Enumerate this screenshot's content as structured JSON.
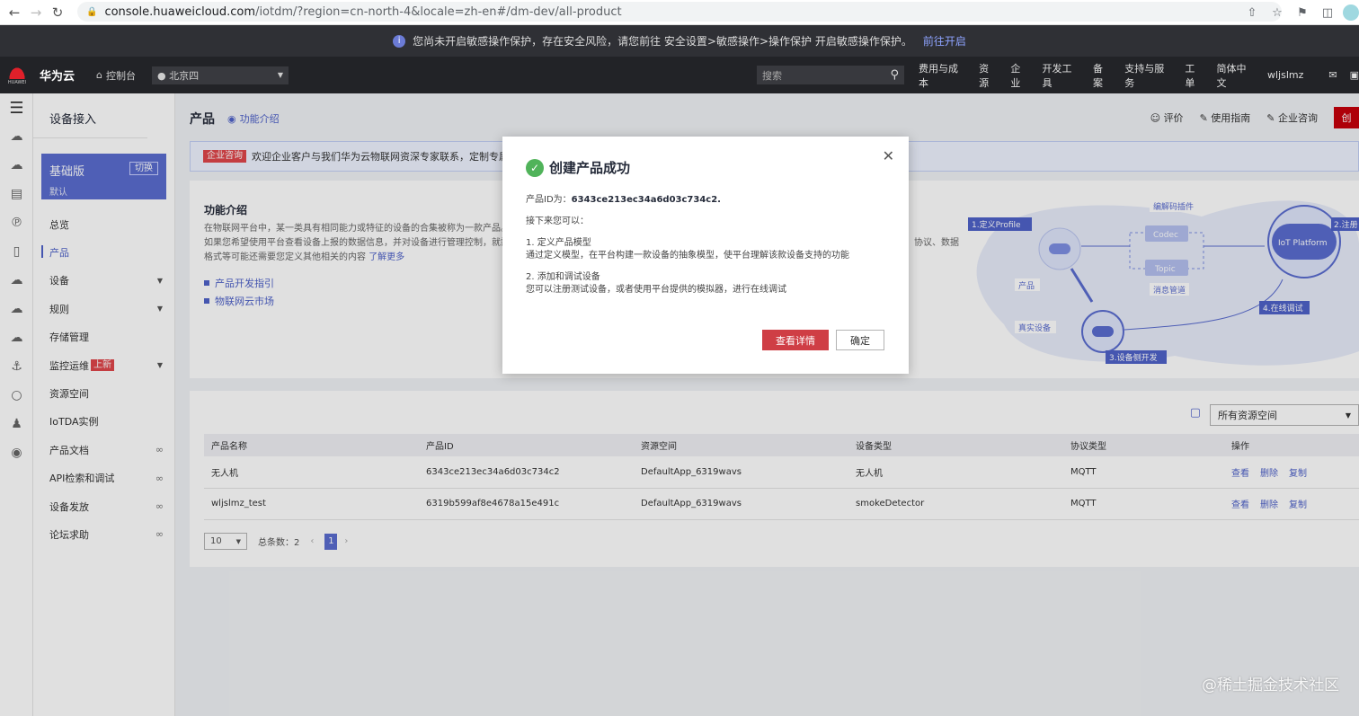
{
  "browser": {
    "url_host": "console.huaweicloud.com",
    "url_path": "/iotdm/?region=cn-north-4&locale=zh-en#/dm-dev/all-product"
  },
  "warning": {
    "text": "您尚未开启敏感操作保护，存在安全风险，请您前往 安全设置>敏感操作>操作保护 开启敏感操作保护。",
    "link": "前往开启"
  },
  "topnav": {
    "logo_text": "HUAWEI",
    "brand": "华为云",
    "console": "控制台",
    "region": "北京四",
    "search_placeholder": "搜索",
    "menu": [
      "费用与成本",
      "资源",
      "企业",
      "开发工具",
      "备案",
      "支持与服务",
      "工单",
      "简体中文",
      "wljslmz"
    ]
  },
  "sidebar": {
    "title": "设备接入",
    "edition": "基础版",
    "edition_sub": "默认",
    "switch": "切换",
    "items": [
      {
        "label": "总览"
      },
      {
        "label": "产品"
      },
      {
        "label": "设备"
      },
      {
        "label": "规则"
      },
      {
        "label": "存储管理"
      },
      {
        "label": "监控运维"
      },
      {
        "label": "资源空间"
      },
      {
        "label": "IoTDA实例"
      },
      {
        "label": "产品文档"
      },
      {
        "label": "API检索和调试"
      },
      {
        "label": "设备发放"
      },
      {
        "label": "论坛求助"
      }
    ],
    "new_badge": "上新"
  },
  "main": {
    "title": "产品",
    "func_intro": "功能介绍",
    "actions": [
      "评价",
      "使用指南",
      "企业咨询"
    ],
    "create": "创",
    "promo_tag": "企业咨询",
    "promo_text": "欢迎企业客户与我们华为云物联网资深专家联系，定制专属物联网",
    "intro": {
      "title": "功能介绍",
      "line1": "在物联网平台中，某一类具有相同能力或特征的设备的合集被称为一款产品。",
      "line2": "如果您希望使用平台查看设备上报的数据信息，并对设备进行管理控制，就需",
      "line2_tail": "协议、数据",
      "line3": "格式等可能还需要您定义其他相关的内容",
      "more": "了解更多",
      "links": [
        "产品开发指引",
        "物联网云市场"
      ]
    },
    "flow": {
      "step1": "1.定义Profile",
      "step2": "2.注册",
      "step3": "3.设备侧开发",
      "step4": "4.在线调试",
      "codec_plugin": "编解码插件",
      "codec": "Codec",
      "topic": "Topic",
      "msg_pipe": "消息管道",
      "product": "产品",
      "real_device": "真实设备",
      "iot_platform": "IoT Platform"
    }
  },
  "table": {
    "space_select": "所有资源空间",
    "headers": [
      "产品名称",
      "产品ID",
      "资源空间",
      "设备类型",
      "协议类型",
      "操作"
    ],
    "rows": [
      {
        "name": "无人机",
        "id": "6343ce213ec34a6d03c734c2",
        "space": "DefaultApp_6319wavs",
        "type": "无人机",
        "protocol": "MQTT"
      },
      {
        "name": "wljslmz_test",
        "id": "6319b599af8e4678a15e491c",
        "space": "DefaultApp_6319wavs",
        "type": "smokeDetector",
        "protocol": "MQTT"
      }
    ],
    "ops": [
      "查看",
      "删除",
      "复制"
    ],
    "page_size": "10",
    "total": "总条数：2",
    "page": "1"
  },
  "modal": {
    "title": "创建产品成功",
    "id_label": "产品ID为：",
    "id_value": "6343ce213ec34a6d03c734c2.",
    "next": "接下来您可以：",
    "step1_title": "1. 定义产品模型",
    "step1_desc": "通过定义模型，在平台构建一款设备的抽象模型，使平台理解该款设备支持的功能",
    "step2_title": "2. 添加和调试设备",
    "step2_desc": "您可以注册测试设备，或者使用平台提供的模拟器，进行在线调试",
    "detail_btn": "查看详情",
    "ok_btn": "确定"
  },
  "watermark": "@稀土掘金技术社区"
}
